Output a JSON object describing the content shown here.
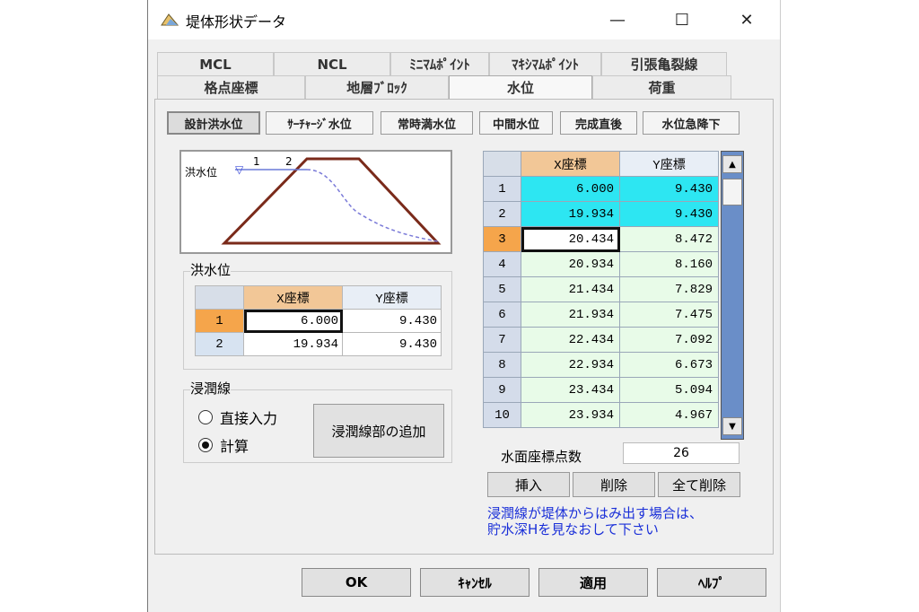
{
  "window": {
    "title": "堤体形状データ",
    "minimize": "—",
    "maximize": "☐",
    "close": "✕"
  },
  "tabs_top": [
    "MCL",
    "NCL",
    "ﾐﾆﾏﾑﾎﾟｲﾝﾄ",
    "ﾏｷｼﾏﾑﾎﾟｲﾝﾄ",
    "引張亀裂線"
  ],
  "tabs_bottom": [
    "格点座標",
    "地層ﾌﾞﾛｯｸ",
    "水位",
    "荷重"
  ],
  "subtabs": [
    "設計洪水位",
    "ｻｰﾁｬｰｼﾞ水位",
    "常時満水位",
    "中間水位",
    "完成直後",
    "水位急降下"
  ],
  "diagram": {
    "label": "洪水位",
    "p1": "1",
    "p2": "2"
  },
  "flood": {
    "group_label": "洪水位",
    "headers": [
      "X座標",
      "Y座標"
    ],
    "rows": [
      {
        "n": "1",
        "x": "6.000",
        "y": "9.430"
      },
      {
        "n": "2",
        "x": "19.934",
        "y": "9.430"
      }
    ]
  },
  "seepage": {
    "group_label": "浸潤線",
    "option_direct": "直接入力",
    "option_calc": "計算",
    "add_button": "浸潤線部の追加"
  },
  "water_table": {
    "headers": [
      "X座標",
      "Y座標"
    ],
    "rows": [
      {
        "n": "1",
        "x": "6.000",
        "y": "9.430"
      },
      {
        "n": "2",
        "x": "19.934",
        "y": "9.430"
      },
      {
        "n": "3",
        "x": "20.434",
        "y": "8.472"
      },
      {
        "n": "4",
        "x": "20.934",
        "y": "8.160"
      },
      {
        "n": "5",
        "x": "21.434",
        "y": "7.829"
      },
      {
        "n": "6",
        "x": "21.934",
        "y": "7.475"
      },
      {
        "n": "7",
        "x": "22.434",
        "y": "7.092"
      },
      {
        "n": "8",
        "x": "22.934",
        "y": "6.673"
      },
      {
        "n": "9",
        "x": "23.434",
        "y": "5.094"
      },
      {
        "n": "10",
        "x": "23.934",
        "y": "4.967"
      }
    ],
    "count_label": "水面座標点数",
    "count_value": "26"
  },
  "row_buttons": {
    "insert": "挿入",
    "delete": "削除",
    "delete_all": "全て削除"
  },
  "note_line1": "浸潤線が堤体からはみ出す場合は、",
  "note_line2": "貯水深Hを見なおして下さい",
  "footer": {
    "ok": "OK",
    "cancel": "ｷｬﾝｾﾙ",
    "apply": "適用",
    "help": "ﾍﾙﾌﾟ"
  }
}
